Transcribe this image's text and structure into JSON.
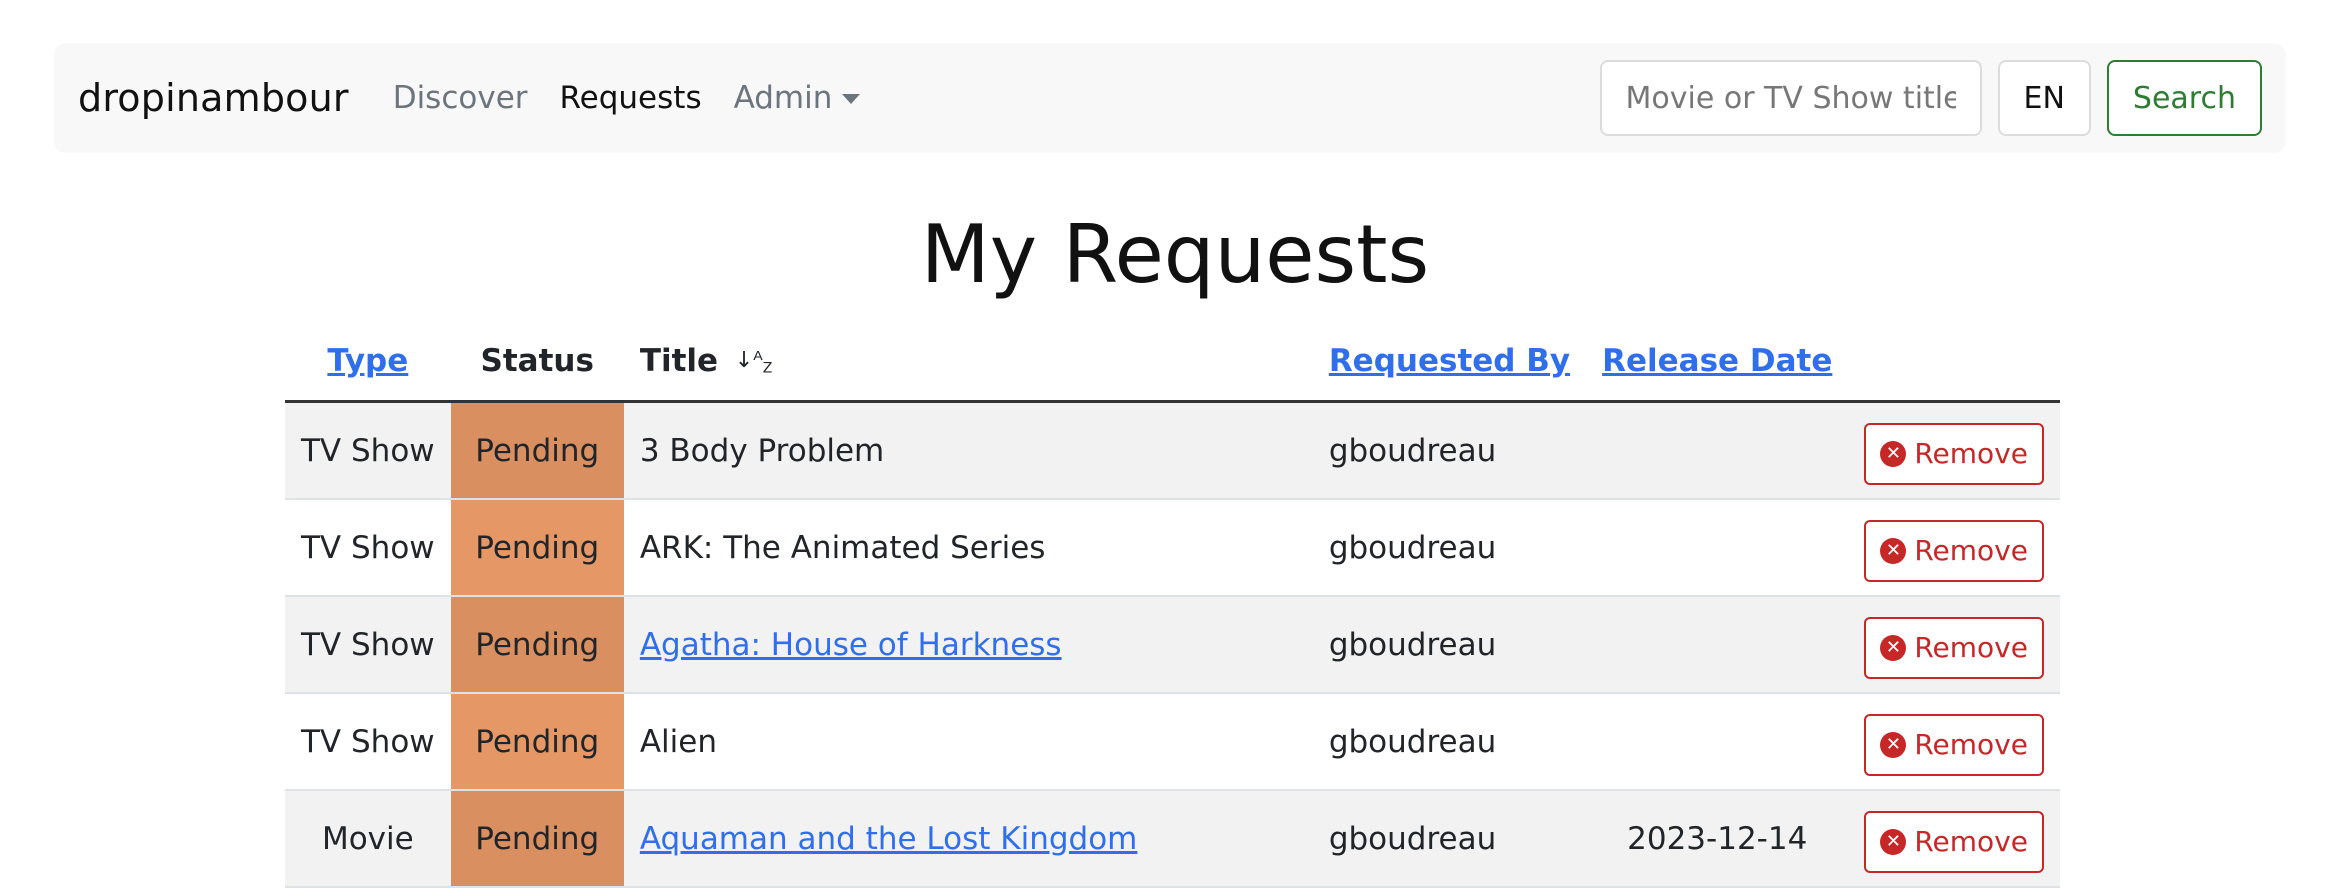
{
  "navbar": {
    "brand": "dropinambour",
    "links": {
      "discover": "Discover",
      "requests": "Requests",
      "admin": "Admin"
    },
    "search_placeholder": "Movie or TV Show title",
    "language": "EN",
    "search_button": "Search"
  },
  "page": {
    "title": "My Requests"
  },
  "table": {
    "headers": {
      "type": "Type",
      "status": "Status",
      "title": "Title",
      "sort_indicator": "↓ᴬ_Z",
      "requested_by": "Requested By",
      "release_date": "Release Date"
    },
    "rows": [
      {
        "type": "TV Show",
        "status": "Pending",
        "title": "3 Body Problem",
        "title_linked": false,
        "requested_by": "gboudreau",
        "release_date": "",
        "action": "Remove"
      },
      {
        "type": "TV Show",
        "status": "Pending",
        "title": "ARK: The Animated Series",
        "title_linked": false,
        "requested_by": "gboudreau",
        "release_date": "",
        "action": "Remove"
      },
      {
        "type": "TV Show",
        "status": "Pending",
        "title": "Agatha: House of Harkness",
        "title_linked": true,
        "requested_by": "gboudreau",
        "release_date": "",
        "action": "Remove"
      },
      {
        "type": "TV Show",
        "status": "Pending",
        "title": "Alien",
        "title_linked": false,
        "requested_by": "gboudreau",
        "release_date": "",
        "action": "Remove"
      },
      {
        "type": "Movie",
        "status": "Pending",
        "title": "Aquaman and the Lost Kingdom",
        "title_linked": true,
        "requested_by": "gboudreau",
        "release_date": "2023-12-14",
        "action": "Remove"
      }
    ]
  },
  "colors": {
    "link": "#2f6fec",
    "pending_status": "#e59866",
    "search_green": "#2e7d32",
    "remove_red": "#c62828"
  },
  "icons": {
    "dropdown": "caret-down-icon",
    "sort": "sort-alpha-down-icon",
    "remove": "x-circle-icon"
  }
}
